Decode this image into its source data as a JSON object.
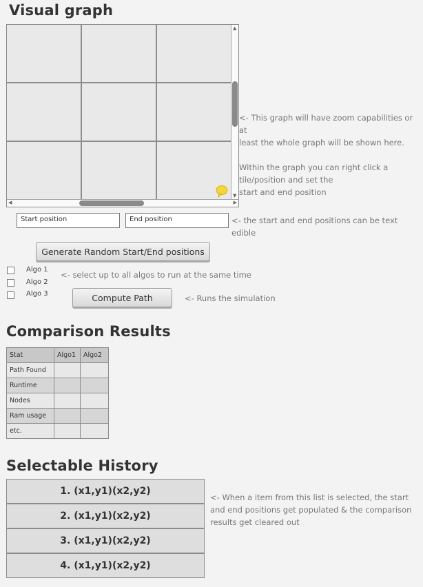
{
  "visual_graph": {
    "title": "Visual graph",
    "note": [
      "<- This graph will have zoom capabilities or at",
      "least the whole graph will be shown here.",
      "",
      "Within the graph you can right click a",
      "tile/position and set the",
      "start and end position"
    ]
  },
  "positions": {
    "start_value": "Start position",
    "end_value": "End position",
    "note": "<- the start and end positions can be text edible"
  },
  "generate_button": "Generate Random Start/End positions",
  "algos": {
    "items": [
      "Algo 1",
      "Algo 2",
      "Algo 3"
    ],
    "note": "<- select up to all algos to run at the same time"
  },
  "compute": {
    "button": "Compute Path",
    "note": "<- Runs the simulation"
  },
  "comparison": {
    "title": "Comparison Results",
    "headers": [
      "Stat",
      "Algo1",
      "Algo2"
    ],
    "rows": [
      "Path Found",
      "Runtime",
      "Nodes",
      "Ram usage",
      "etc."
    ]
  },
  "history": {
    "title": "Selectable History",
    "items": [
      "1. (x1,y1)(x2,y2)",
      "2. (x1,y1)(x2,y2)",
      "3. (x1,y1)(x2,y2)",
      "4. (x1,y1)(x2,y2)"
    ],
    "note": [
      "<- When a item from this list is selected, the start",
      "and end positions get populated & the comparison",
      "results get cleared out"
    ]
  },
  "colors": {
    "background": "#f3f3f3",
    "grid_tile": "#e9e9e9",
    "grid_line": "#8d8d8d",
    "marker": "#f5d63a",
    "note_text": "#777777"
  }
}
